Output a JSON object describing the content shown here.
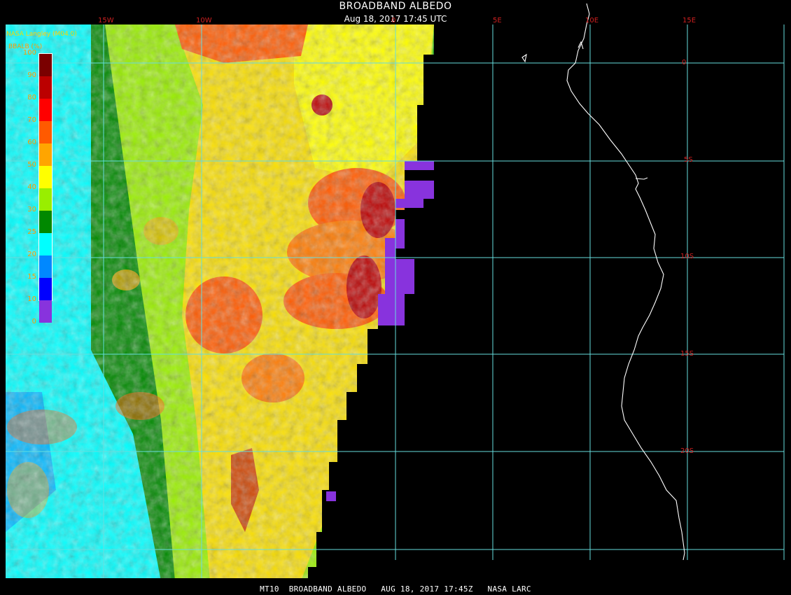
{
  "header": {
    "title": "BROADBAND ALBEDO",
    "datetime": "Aug 18, 2017 17:45 UTC"
  },
  "footer": {
    "text": "MT10  BROADBAND ALBEDO   AUG 18, 2017 17:45Z   NASA LARC"
  },
  "provider": "NASA Langley (M04.0)",
  "legend": {
    "title": "BBALB (%)",
    "stops": [
      {
        "label": "100",
        "color": "#7a0000"
      },
      {
        "label": "90",
        "color": "#bb0000"
      },
      {
        "label": "80",
        "color": "#ff0000"
      },
      {
        "label": "70",
        "color": "#ff5a00"
      },
      {
        "label": "60",
        "color": "#ffa500"
      },
      {
        "label": "50",
        "color": "#ffff00"
      },
      {
        "label": "40",
        "color": "#99ee00"
      },
      {
        "label": "30",
        "color": "#008800"
      },
      {
        "label": "25",
        "color": "#00ffff"
      },
      {
        "label": "20",
        "color": "#0088ff"
      },
      {
        "label": "15",
        "color": "#0000ff"
      },
      {
        "label": "10",
        "color": "#8833dd"
      },
      {
        "label": "0",
        "color": null
      }
    ]
  },
  "graticule": {
    "longitudes": [
      "15W",
      "10W",
      "0",
      "5E",
      "10E",
      "15E"
    ],
    "latitudes": [
      "0",
      "5S",
      "10S",
      "15S",
      "20S"
    ],
    "line_color": "#66dddd",
    "label_color": "#d02020"
  },
  "coastline_color": "#ffffff"
}
